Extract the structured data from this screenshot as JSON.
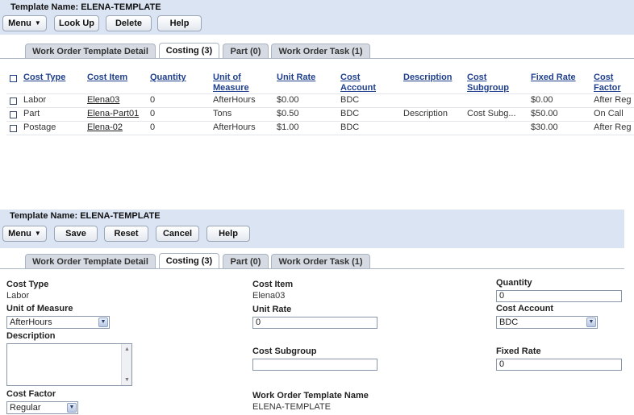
{
  "top": {
    "template_label": "Template Name: ELENA-TEMPLATE",
    "buttons": {
      "menu": "Menu",
      "lookup": "Look Up",
      "delete": "Delete",
      "help": "Help"
    }
  },
  "tabs": [
    {
      "label": "Work Order Template Detail"
    },
    {
      "label": "Costing (3)"
    },
    {
      "label": "Part (0)"
    },
    {
      "label": "Work Order Task (1)"
    }
  ],
  "table": {
    "headers": {
      "cost_type": "Cost Type",
      "cost_item": "Cost Item",
      "quantity": "Quantity",
      "uom_1": "Unit of",
      "uom_2": "Measure",
      "unit_rate": "Unit Rate",
      "cost_account_1": "Cost",
      "cost_account_2": "Account",
      "description": "Description",
      "cost_subgroup_1": "Cost",
      "cost_subgroup_2": "Subgroup",
      "fixed_rate": "Fixed Rate",
      "cost_factor_1": "Cost",
      "cost_factor_2": "Factor"
    },
    "rows": [
      {
        "cost_type": "Labor",
        "cost_item": "Elena03",
        "quantity": "0",
        "uom": "AfterHours",
        "unit_rate": "$0.00",
        "cost_account": "BDC",
        "description": "",
        "cost_subgroup": "",
        "fixed_rate": "$0.00",
        "cost_factor": "After Reg"
      },
      {
        "cost_type": "Part",
        "cost_item": "Elena-Part01",
        "quantity": "0",
        "uom": "Tons",
        "unit_rate": "$0.50",
        "cost_account": "BDC",
        "description": "Description",
        "cost_subgroup": "Cost Subg...",
        "fixed_rate": "$50.00",
        "cost_factor": "On Call"
      },
      {
        "cost_type": "Postage",
        "cost_item": "Elena-02",
        "quantity": "0",
        "uom": "AfterHours",
        "unit_rate": "$1.00",
        "cost_account": "BDC",
        "description": "",
        "cost_subgroup": "",
        "fixed_rate": "$30.00",
        "cost_factor": "After Reg"
      }
    ]
  },
  "bottom": {
    "template_label": "Template Name: ELENA-TEMPLATE",
    "buttons": {
      "menu": "Menu",
      "save": "Save",
      "reset": "Reset",
      "cancel": "Cancel",
      "help": "Help"
    }
  },
  "form": {
    "cost_type_label": "Cost Type",
    "cost_type_value": "Labor",
    "cost_item_label": "Cost Item",
    "cost_item_value": "Elena03",
    "quantity_label": "Quantity",
    "quantity_value": "0",
    "uom_label": "Unit of Measure",
    "uom_value": "AfterHours",
    "unit_rate_label": "Unit Rate",
    "unit_rate_value": "0",
    "cost_account_label": "Cost Account",
    "cost_account_value": "BDC",
    "description_label": "Description",
    "cost_subgroup_label": "Cost Subgroup",
    "cost_subgroup_value": "",
    "fixed_rate_label": "Fixed Rate",
    "fixed_rate_value": "0",
    "cost_factor_label": "Cost Factor",
    "cost_factor_value": "Regular",
    "wot_name_label": "Work Order Template Name",
    "wot_name_value": "ELENA-TEMPLATE"
  }
}
